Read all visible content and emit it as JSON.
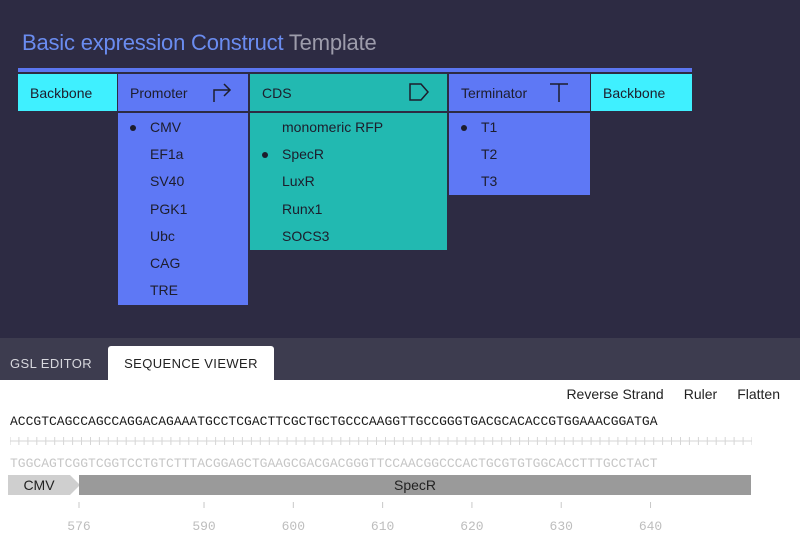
{
  "title": {
    "main": "Basic expression Construct",
    "suffix": "Template"
  },
  "construct": {
    "backbone_left": {
      "label": "Backbone",
      "color": "#3ff0ff"
    },
    "promoter": {
      "label": "Promoter",
      "icon": "promoter-arrow-icon",
      "color": "#5e78f5",
      "options": [
        "CMV",
        "EF1a",
        "SV40",
        "PGK1",
        "Ubc",
        "CAG",
        "TRE"
      ],
      "selected": "CMV"
    },
    "cds": {
      "label": "CDS",
      "icon": "cds-pentagon-icon",
      "color": "#22b9b1",
      "options": [
        "monomeric RFP",
        "SpecR",
        "LuxR",
        "Runx1",
        "SOCS3"
      ],
      "selected": "SpecR"
    },
    "terminator": {
      "label": "Terminator",
      "icon": "terminator-t-icon",
      "color": "#5e78f5",
      "options": [
        "T1",
        "T2",
        "T3"
      ],
      "selected": "T1"
    },
    "backbone_right": {
      "label": "Backbone",
      "color": "#3ff0ff"
    }
  },
  "tabs": {
    "gsl_editor": "GSL EDITOR",
    "sequence_viewer": "SEQUENCE VIEWER",
    "active": "SEQUENCE VIEWER"
  },
  "viewer": {
    "toolbar": {
      "reverse_strand": "Reverse Strand",
      "ruler": "Ruler",
      "flatten": "Flatten"
    },
    "forward_sequence": "ACCGTCAGCCAGCCAGGACAGAAATGCCTCGACTTCGCTGCTGCCCAAGGTTGCCGGGTGACGCACACCGTGGAAACGGATGA",
    "reverse_sequence": "TGGCAGTCGGTCGGTCCTGTCTTTACGGAGCTGAAGCGACGACGGGTTCCAACGGCCCACTGCGTGTGGCACCTTTGCCTACT",
    "features": [
      {
        "label": "CMV",
        "color": "#cfcfcf"
      },
      {
        "label": "SpecR",
        "color": "#9a9a9a"
      }
    ],
    "axis_ticks": [
      576,
      590,
      600,
      610,
      620,
      630,
      640
    ]
  }
}
